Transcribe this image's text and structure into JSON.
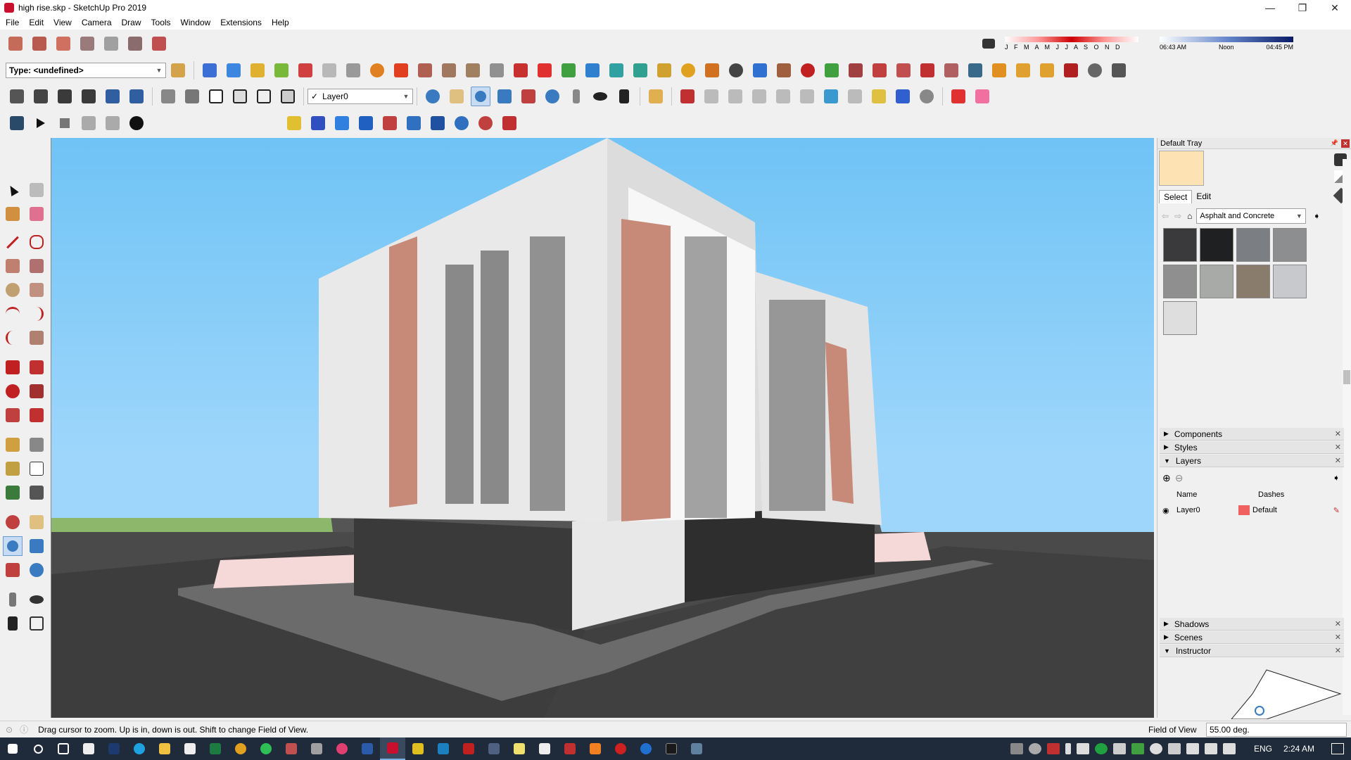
{
  "window": {
    "title": "high rise.skp - SketchUp Pro 2019",
    "controls": [
      "—",
      "❐",
      "✕"
    ]
  },
  "menu": [
    "File",
    "Edit",
    "View",
    "Camera",
    "Draw",
    "Tools",
    "Window",
    "Extensions",
    "Help"
  ],
  "toolbar": {
    "type_combo": "Type: <undefined>",
    "layer_combo": "Layer0",
    "shadow_months": "J F M A M J J A S O N D",
    "time_start": "06:43 AM",
    "time_mid": "Noon",
    "time_end": "04:45 PM"
  },
  "tray": {
    "title": "Default Tray",
    "tabs": [
      "Select",
      "Edit"
    ],
    "material_combo": "Asphalt and Concrete",
    "swatch_colors": [
      "#3a3a3c",
      "#1f2022",
      "#7b7f83",
      "#8c8e90",
      "#8f8f8f",
      "#a8aaa8",
      "#8a7c6c",
      "#c7c9cc",
      "#dedede"
    ],
    "preview_color": "#fde2b4",
    "panels": {
      "components": "Components",
      "styles": "Styles",
      "layers": "Layers",
      "shadows": "Shadows",
      "scenes": "Scenes",
      "instructor": "Instructor"
    },
    "layers_table": {
      "col_name": "Name",
      "col_dashes": "Dashes",
      "row_name": "Layer0",
      "row_dashes": "Default",
      "row_color": "#f06060"
    }
  },
  "status": {
    "message": "Drag cursor to zoom.  Up is in, down is out. Shift to change Field of View.",
    "measure_label": "Field of View",
    "measure_value": "55.00 deg."
  },
  "taskbar": {
    "lang": "ENG",
    "time": "2:24 AM"
  }
}
